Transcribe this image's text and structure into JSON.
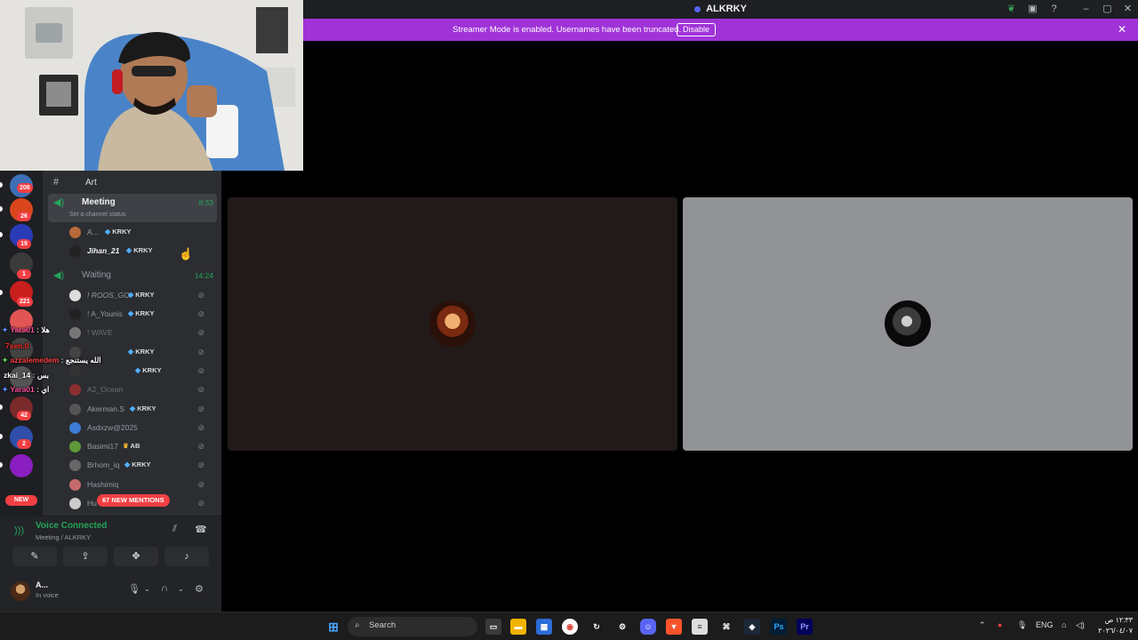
{
  "window": {
    "title": "ALKRKY"
  },
  "banner": {
    "text": "Streamer Mode is enabled. Usernames have been truncated.",
    "button": "Disable",
    "color": "#a033d8"
  },
  "servers": [
    {
      "badge": "208",
      "color": "#3d6fb5"
    },
    {
      "badge": "26",
      "color": "#d9461e"
    },
    {
      "badge": "19",
      "color": "#2a3bb8"
    },
    {
      "badge": "1",
      "color": "#3a3a3a"
    },
    {
      "badge": "221",
      "color": "#c81e1e"
    },
    {
      "badge": "",
      "color": "#e25555"
    },
    {
      "badge": "",
      "color": "#444444"
    },
    {
      "badge": "",
      "color": "#555555"
    },
    {
      "badge": "42",
      "color": "#7a2a2a"
    },
    {
      "badge": "2",
      "color": "#2f4faa"
    },
    {
      "badge": "",
      "color": "#8a1ec0"
    },
    {
      "badge": "NEW",
      "color": "#333333"
    }
  ],
  "channels": {
    "art": "Art",
    "meeting": {
      "name": "Meeting",
      "time": "8:33",
      "status": "Set a channel status"
    },
    "waiting": {
      "name": "Waiting",
      "time": "14:24"
    }
  },
  "meeting_users": [
    {
      "name": "A...",
      "tag": "KRKY"
    },
    {
      "name": "Jihan_21",
      "tag": "KRKY"
    }
  ],
  "waiting_users": [
    {
      "name": "! ROOS_GO",
      "tag": "KRKY"
    },
    {
      "name": "! A_Younis",
      "tag": "KRKY"
    },
    {
      "name": "! WAVE",
      "tag": ""
    },
    {
      "name": "",
      "tag": "KRKY"
    },
    {
      "name": "",
      "tag": "KRKY"
    },
    {
      "name": "A2_Ocean",
      "tag": ""
    },
    {
      "name": "Akerman.S",
      "tag": "KRKY"
    },
    {
      "name": "Asdxzw@2025",
      "tag": ""
    },
    {
      "name": "Basimi17",
      "tag": "AB"
    },
    {
      "name": "Brhom_iq",
      "tag": "KRKY"
    },
    {
      "name": "Hashimiq",
      "tag": ""
    },
    {
      "name": "Hu",
      "tag": ""
    }
  ],
  "mentions": "67 NEW MENTIONS",
  "new_label": "NEW",
  "voice": {
    "title": "Voice Connected",
    "subtitle": "Meeting / ALKRKY"
  },
  "user": {
    "name": "A...",
    "status": "In voice"
  },
  "overlay_chat": [
    {
      "user": "Yara01",
      "msg": "هلا",
      "color": "#ff4fa3"
    },
    {
      "user": "7sen.0",
      "msg": "",
      "color": "#ff2b2b"
    },
    {
      "user": "azzalemedem",
      "msg": "الله يستنجع",
      "color": "#ff4040"
    },
    {
      "user": "zkai_14",
      "msg": "بس",
      "color": "#ffffff"
    },
    {
      "user": "Yara01",
      "msg": "اي",
      "color": "#ff4fa3"
    }
  ],
  "taskbar": {
    "search": "Search",
    "lang": "ENG",
    "time": "١٢:٣٣ ص",
    "date": "٢٠٢٦/٠٤/٠٧"
  }
}
